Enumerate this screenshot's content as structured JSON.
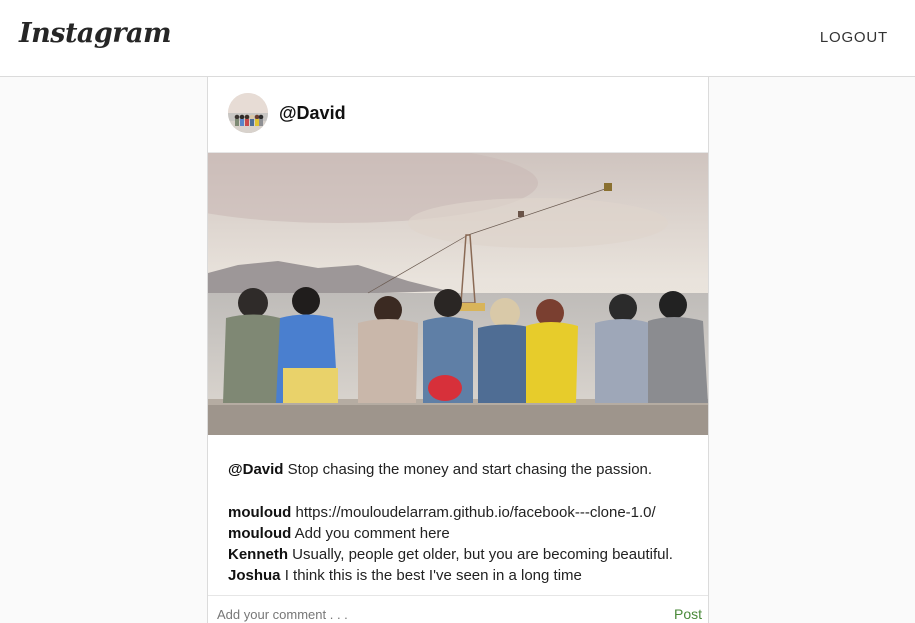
{
  "header": {
    "logo": "Instagram",
    "logout_label": "LOGOUT"
  },
  "post": {
    "username": "@David",
    "caption": {
      "author": "@David",
      "text": "Stop chasing the money and start chasing the passion."
    },
    "comments": [
      {
        "author": "mouloud",
        "text": "https://mouloudelarram.github.io/facebook---clone-1.0/"
      },
      {
        "author": "mouloud",
        "text": "Add you comment here"
      },
      {
        "author": "Kenneth",
        "text": "Usually, people get older, but you are becoming beautiful."
      },
      {
        "author": "Joshua",
        "text": "I think this is the best I've seen in a long time"
      }
    ],
    "comment_input": {
      "placeholder": "Add your comment . . .",
      "value": ""
    },
    "post_label": "Post"
  },
  "colors": {
    "post_button": "#4a8a3a",
    "border": "#dbdbdb"
  }
}
